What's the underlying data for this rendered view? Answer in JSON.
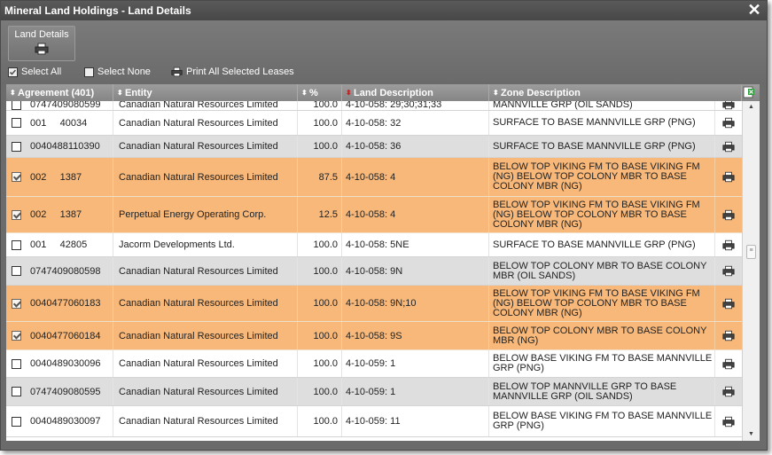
{
  "window": {
    "title": "Mineral Land Holdings - Land Details",
    "close_glyph": "✕"
  },
  "toolbar": {
    "land_details_button": {
      "label": "Land Details",
      "icon": "printer-icon"
    },
    "select_all": {
      "label": "Select All",
      "checked": true
    },
    "select_none": {
      "label": "Select None",
      "checked": false
    },
    "print_all": {
      "label": "Print All Selected Leases",
      "icon": "printer-icon"
    }
  },
  "grid": {
    "columns": {
      "agreement": "Agreement (401)",
      "entity": "Entity",
      "percent": "%",
      "land_description": "Land Description",
      "zone_description": "Zone Description"
    },
    "active_sort_color": "#cc2020",
    "rows": [
      {
        "checked": false,
        "agreement": "0747409080599",
        "entity": "Canadian Natural Resources Limited",
        "percent": "100.0",
        "land": "4-10-058: 29;30;31;33",
        "zone": "MANNVILLE GRP (OIL SANDS)",
        "style": "white",
        "partial": true
      },
      {
        "checked": false,
        "agreement": "001     40034",
        "entity": "Canadian Natural Resources Limited",
        "percent": "100.0",
        "land": "4-10-058: 32",
        "zone": "SURFACE TO BASE MANNVILLE GRP (PNG)",
        "style": "white"
      },
      {
        "checked": false,
        "agreement": "0040488110390",
        "entity": "Canadian Natural Resources Limited",
        "percent": "100.0",
        "land": "4-10-058: 36",
        "zone": "SURFACE TO BASE MANNVILLE GRP (PNG)",
        "style": "gray"
      },
      {
        "checked": true,
        "agreement": "002     1387",
        "entity": "Canadian Natural Resources Limited",
        "percent": "87.5",
        "land": "4-10-058: 4",
        "zone": "BELOW TOP VIKING FM TO BASE VIKING FM (NG) BELOW TOP COLONY MBR TO BASE COLONY MBR (NG)",
        "style": "sel"
      },
      {
        "checked": true,
        "agreement": "002     1387",
        "entity": "Perpetual Energy Operating Corp.",
        "percent": "12.5",
        "land": "4-10-058: 4",
        "zone": "BELOW TOP VIKING FM TO BASE VIKING FM (NG) BELOW TOP COLONY MBR TO BASE COLONY MBR (NG)",
        "style": "sel"
      },
      {
        "checked": false,
        "agreement": "001     42805",
        "entity": "Jacorm Developments Ltd.",
        "percent": "100.0",
        "land": "4-10-058: 5NE",
        "zone": "SURFACE TO BASE MANNVILLE GRP (PNG)",
        "style": "white"
      },
      {
        "checked": false,
        "agreement": "0747409080598",
        "entity": "Canadian Natural Resources Limited",
        "percent": "100.0",
        "land": "4-10-058: 9N",
        "zone": "BELOW TOP COLONY MBR TO BASE COLONY MBR (OIL SANDS)",
        "style": "gray"
      },
      {
        "checked": true,
        "agreement": "0040477060183",
        "entity": "Canadian Natural Resources Limited",
        "percent": "100.0",
        "land": "4-10-058: 9N;10",
        "zone": "BELOW TOP VIKING FM TO BASE VIKING FM (NG) BELOW TOP COLONY MBR TO BASE COLONY MBR (NG)",
        "style": "sel"
      },
      {
        "checked": true,
        "agreement": "0040477060184",
        "entity": "Canadian Natural Resources Limited",
        "percent": "100.0",
        "land": "4-10-058: 9S",
        "zone": "BELOW TOP COLONY MBR TO BASE COLONY MBR (NG)",
        "style": "sel"
      },
      {
        "checked": false,
        "agreement": "0040489030096",
        "entity": "Canadian Natural Resources Limited",
        "percent": "100.0",
        "land": "4-10-059: 1",
        "zone": "BELOW BASE VIKING FM TO BASE MANNVILLE GRP (PNG)",
        "style": "white"
      },
      {
        "checked": false,
        "agreement": "0747409080595",
        "entity": "Canadian Natural Resources Limited",
        "percent": "100.0",
        "land": "4-10-059: 1",
        "zone": "BELOW TOP MANNVILLE GRP TO BASE MANNVILLE GRP (OIL SANDS)",
        "style": "gray"
      },
      {
        "checked": false,
        "agreement": "0040489030097",
        "entity": "Canadian Natural Resources Limited",
        "percent": "100.0",
        "land": "4-10-059: 11",
        "zone": "BELOW BASE VIKING FM TO BASE MANNVILLE GRP (PNG)",
        "style": "white"
      }
    ]
  },
  "scrollbar": {
    "up_icon": "▲",
    "down_icon": "▼",
    "thumb_grip": "≡"
  }
}
